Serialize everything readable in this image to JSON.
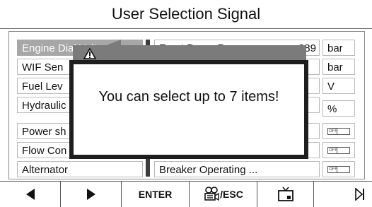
{
  "screen": {
    "title": "User Selection Signal"
  },
  "left_list": {
    "items": [
      {
        "label": "Engine Dial Voltage",
        "selected": true
      },
      {
        "label": "WIF Sen",
        "selected": false
      },
      {
        "label": "Fuel Lev",
        "selected": false
      },
      {
        "label": "Hydraulic",
        "selected": false
      },
      {
        "label": "Power sh",
        "selected": false
      },
      {
        "label": "Flow Con",
        "selected": false
      },
      {
        "label": "Alternator",
        "selected": false
      }
    ]
  },
  "right_list": {
    "rows": [
      {
        "label": "Front Pump Pressure",
        "value": "289",
        "unit": "bar"
      },
      {
        "label": "",
        "value": "",
        "unit": "bar"
      },
      {
        "label": "",
        "value": "",
        "unit": "V"
      },
      {
        "label": "",
        "value": "",
        "unit": "%"
      },
      {
        "label": "",
        "value": "",
        "unit": "",
        "toggle": "OFF"
      },
      {
        "label": "",
        "value": "",
        "unit": "",
        "toggle": "OFF"
      },
      {
        "label": "Breaker Operating ...",
        "value": "",
        "unit": "",
        "toggle": "OFF"
      }
    ]
  },
  "popup": {
    "icon": "warning-icon",
    "message": "You can select up to 7 items!"
  },
  "toolbar": {
    "buttons": [
      {
        "icon": "left-arrow-icon",
        "label": ""
      },
      {
        "icon": "right-arrow-icon",
        "label": ""
      },
      {
        "icon": "",
        "label": "ENTER"
      },
      {
        "icon": "camera-icon",
        "label": "/ESC"
      },
      {
        "icon": "monitor-icon",
        "label": ""
      },
      {
        "icon": "skip-end-icon",
        "label": ""
      }
    ]
  }
}
